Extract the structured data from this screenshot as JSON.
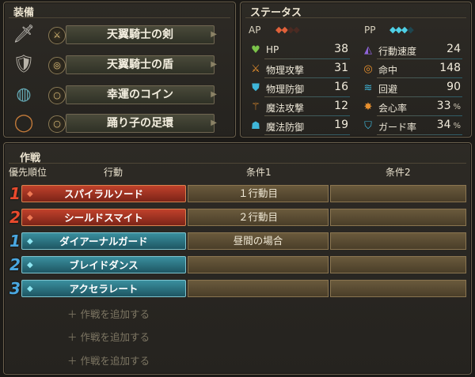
{
  "equipment": {
    "title": "装備",
    "items": [
      {
        "name": "天翼騎士の剣",
        "icon": "sword-icon",
        "slot_icon": "sword-slot-icon"
      },
      {
        "name": "天翼騎士の盾",
        "icon": "shield-icon",
        "slot_icon": "shield-slot-icon"
      },
      {
        "name": "幸運のコイン",
        "icon": "coin-icon",
        "slot_icon": "ring-slot-icon"
      },
      {
        "name": "踊り子の足環",
        "icon": "anklet-icon",
        "slot_icon": "ring-slot-icon"
      }
    ]
  },
  "status": {
    "title": "ステータス",
    "ap_label": "AP",
    "ap_gems_filled": 2,
    "ap_gems_total": 4,
    "pp_label": "PP",
    "pp_gems_filled": 3,
    "pp_gems_total": 4,
    "left": [
      {
        "label": "HP",
        "value": "38",
        "icon": "heart-icon",
        "color": "#7bc34a"
      },
      {
        "label": "物理攻撃",
        "value": "31",
        "icon": "sword-stat-icon",
        "color": "#e9912e"
      },
      {
        "label": "物理防御",
        "value": "16",
        "icon": "armor-icon",
        "color": "#3fb6d9"
      },
      {
        "label": "魔法攻撃",
        "value": "12",
        "icon": "staff-icon",
        "color": "#e9912e"
      },
      {
        "label": "魔法防御",
        "value": "19",
        "icon": "magic-shield-icon",
        "color": "#3fb6d9"
      }
    ],
    "right": [
      {
        "label": "行動速度",
        "value": "24",
        "icon": "speed-icon",
        "color": "#8e64d8"
      },
      {
        "label": "命中",
        "value": "148",
        "icon": "target-icon",
        "color": "#e9912e"
      },
      {
        "label": "回避",
        "value": "90",
        "icon": "evade-icon",
        "color": "#3fb6d9"
      },
      {
        "label": "会心率",
        "value": "33",
        "unit": "%",
        "icon": "critical-icon",
        "color": "#e9912e"
      },
      {
        "label": "ガード率",
        "value": "34",
        "unit": "%",
        "icon": "guard-icon",
        "color": "#3fb6d9"
      }
    ]
  },
  "tactics": {
    "title": "作戦",
    "headers": {
      "priority": "優先順位",
      "action": "行動",
      "cond1": "条件1",
      "cond2": "条件2"
    },
    "rows": [
      {
        "priority": "1",
        "type": "red",
        "action": "スパイラルソード",
        "cond1": "１行動目",
        "cond2": ""
      },
      {
        "priority": "2",
        "type": "red",
        "action": "シールドスマイト",
        "cond1": "２行動目",
        "cond2": ""
      },
      {
        "priority": "1",
        "type": "blue",
        "action": "ダイアーナルガード",
        "cond1": "昼間の場合",
        "cond2": ""
      },
      {
        "priority": "2",
        "type": "blue",
        "action": "ブレイドダンス",
        "cond1": "",
        "cond2": ""
      },
      {
        "priority": "3",
        "type": "blue",
        "action": "アクセラレート",
        "cond1": "",
        "cond2": ""
      }
    ],
    "add_label": "＋ 作戦を追加する",
    "add_count": 3
  },
  "colors": {
    "red_accent": "#c0412b",
    "blue_accent": "#3a8f9e",
    "ap_gem": "#e0613a",
    "pp_gem": "#4fd0e6"
  }
}
